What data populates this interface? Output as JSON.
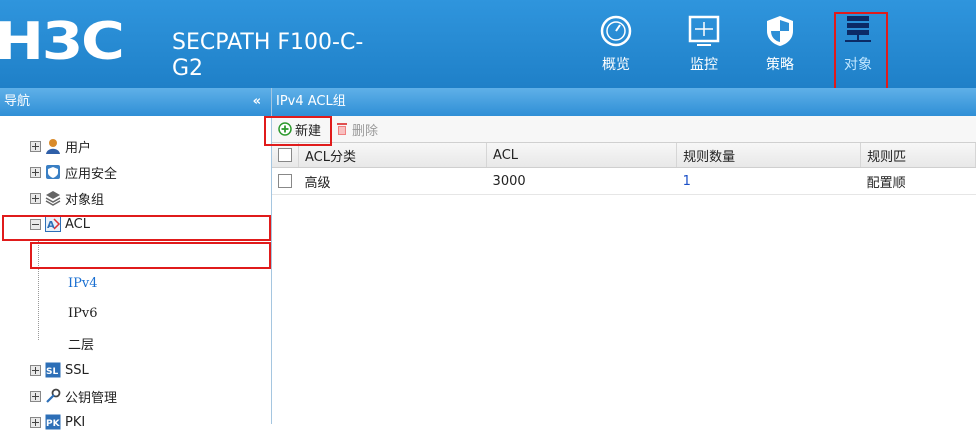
{
  "header": {
    "logo": "H3C",
    "product_line1": "SECPATH F100-C-",
    "product_line2": "G2",
    "nav": [
      {
        "label": "概览",
        "icon": "dashboard-icon"
      },
      {
        "label": "监控",
        "icon": "monitor-icon"
      },
      {
        "label": "策略",
        "icon": "shield-icon"
      },
      {
        "label": "对象",
        "icon": "object-stack-icon",
        "active": true
      }
    ]
  },
  "sidebar": {
    "title": "导航",
    "collapse": "«",
    "items": [
      {
        "label": "用户",
        "icon": "user-icon"
      },
      {
        "label": "应用安全",
        "icon": "app-security-icon"
      },
      {
        "label": "对象组",
        "icon": "object-group-icon"
      },
      {
        "label": "ACL",
        "icon": "acl-icon",
        "expanded": true
      },
      {
        "label": "IPv4",
        "child": true,
        "selected": true
      },
      {
        "label": "IPv6",
        "child": true
      },
      {
        "label": "二层",
        "child": true
      },
      {
        "label": "SSL",
        "icon": "ssl-icon"
      },
      {
        "label": "公钥管理",
        "icon": "key-icon"
      },
      {
        "label": "PKI",
        "icon": "pki-icon"
      }
    ]
  },
  "main": {
    "title": "IPv4 ACL组",
    "toolbar": {
      "new_label": "新建",
      "delete_label": "删除"
    },
    "columns": [
      "ACL分类",
      "ACL",
      "规则数量",
      "规则匹"
    ],
    "rows": [
      {
        "category": "高级",
        "acl": "3000",
        "rule_count": "1",
        "rule_match": "配置顺"
      }
    ]
  },
  "colors": {
    "header_blue": "#2f95dd",
    "highlight_red": "#e01b1b",
    "link_blue": "#1a4fc7"
  }
}
